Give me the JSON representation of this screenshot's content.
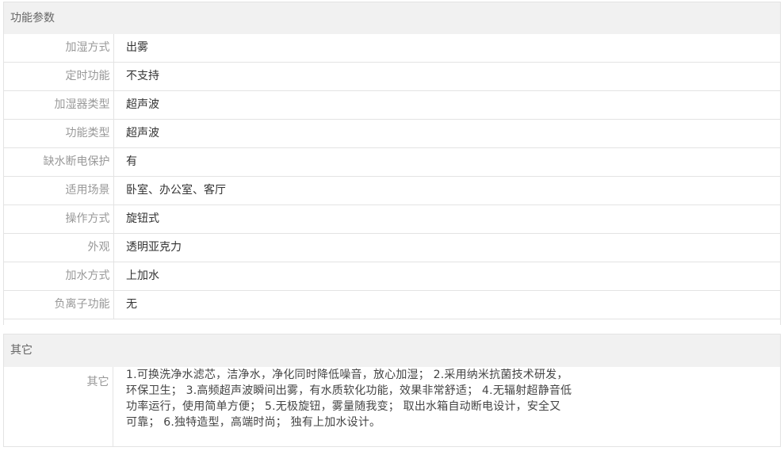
{
  "section_function": {
    "title": "功能参数",
    "rows": [
      {
        "label": "加湿方式",
        "value": "出雾"
      },
      {
        "label": "定时功能",
        "value": "不支持"
      },
      {
        "label": "加湿器类型",
        "value": "超声波"
      },
      {
        "label": "功能类型",
        "value": "超声波"
      },
      {
        "label": "缺水断电保护",
        "value": "有"
      },
      {
        "label": "适用场景",
        "value": "卧室、办公室、客厅"
      },
      {
        "label": "操作方式",
        "value": "旋钮式"
      },
      {
        "label": "外观",
        "value": "透明亚克力"
      },
      {
        "label": "加水方式",
        "value": "上加水"
      },
      {
        "label": "负离子功能",
        "value": "无"
      }
    ]
  },
  "section_other": {
    "title": "其它",
    "label": "其它",
    "lines": [
      "1.可换洗净水滤芯，洁净水，净化同时降低噪音，放心加湿； 2.采用纳米抗菌技术研发，",
      "环保卫生； 3.高频超声波瞬间出雾，有水质软化功能，效果非常舒适； 4.无辐射超静音低",
      "功率运行，使用简单方便； 5.无极旋钮，雾量随我变； 取出水箱自动断电设计，安全又",
      "可靠； 6.独特造型，高端时尚； 独有上加水设计。"
    ]
  }
}
